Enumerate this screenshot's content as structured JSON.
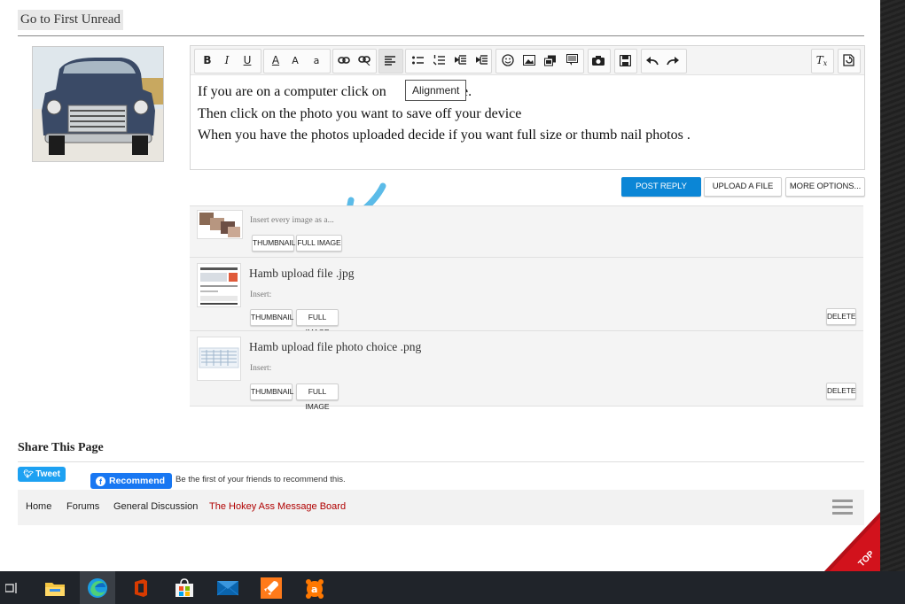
{
  "header": {
    "goto_label": "Go to First Unread"
  },
  "editor": {
    "toolbar": {
      "bold": "B",
      "italic": "I",
      "underline": "U",
      "font_color": "A",
      "font_size": "A",
      "font_family": "a"
    },
    "lines": [
      {
        "before": "If you are on a computer click on",
        "after": "file."
      },
      {
        "text": "Then click on the photo you want to save off your device"
      },
      {
        "text": "When you have the photos uploaded decide if you want full size or thumb nail photos ."
      }
    ],
    "tooltip": "Alignment"
  },
  "actions": {
    "post_reply": "POST REPLY",
    "upload_file": "UPLOAD A FILE",
    "more_options": "MORE OPTIONS..."
  },
  "attachments": {
    "insert_all_label": "Insert every image as a...",
    "thumbnail_label": "THUMBNAIL",
    "full_image_label": "FULL IMAGE",
    "insert_label": "Insert:",
    "delete_label": "DELETE",
    "files": [
      {
        "name": "Hamb upload file .jpg"
      },
      {
        "name": "Hamb upload file photo choice .png"
      }
    ]
  },
  "share": {
    "title": "Share This Page",
    "tweet_label": "Tweet",
    "fb_label": "Recommend",
    "fb_text": "Be the first of your friends to recommend this."
  },
  "nav": {
    "items": [
      "Home",
      "Forums",
      "General Discussion",
      "The Hokey Ass Message Board"
    ],
    "active_color": "#b00000"
  },
  "corner_badge": "TOP",
  "taskbar": {
    "icons": [
      "task-view-icon",
      "file-explorer-icon",
      "edge-icon",
      "office-icon",
      "store-icon",
      "mail-icon",
      "rocket-app-icon",
      "avast-icon"
    ]
  },
  "colors": {
    "accent_blue": "#0b86d6",
    "arrow_blue": "#5bbbe8",
    "corner_red": "#c4121a"
  }
}
